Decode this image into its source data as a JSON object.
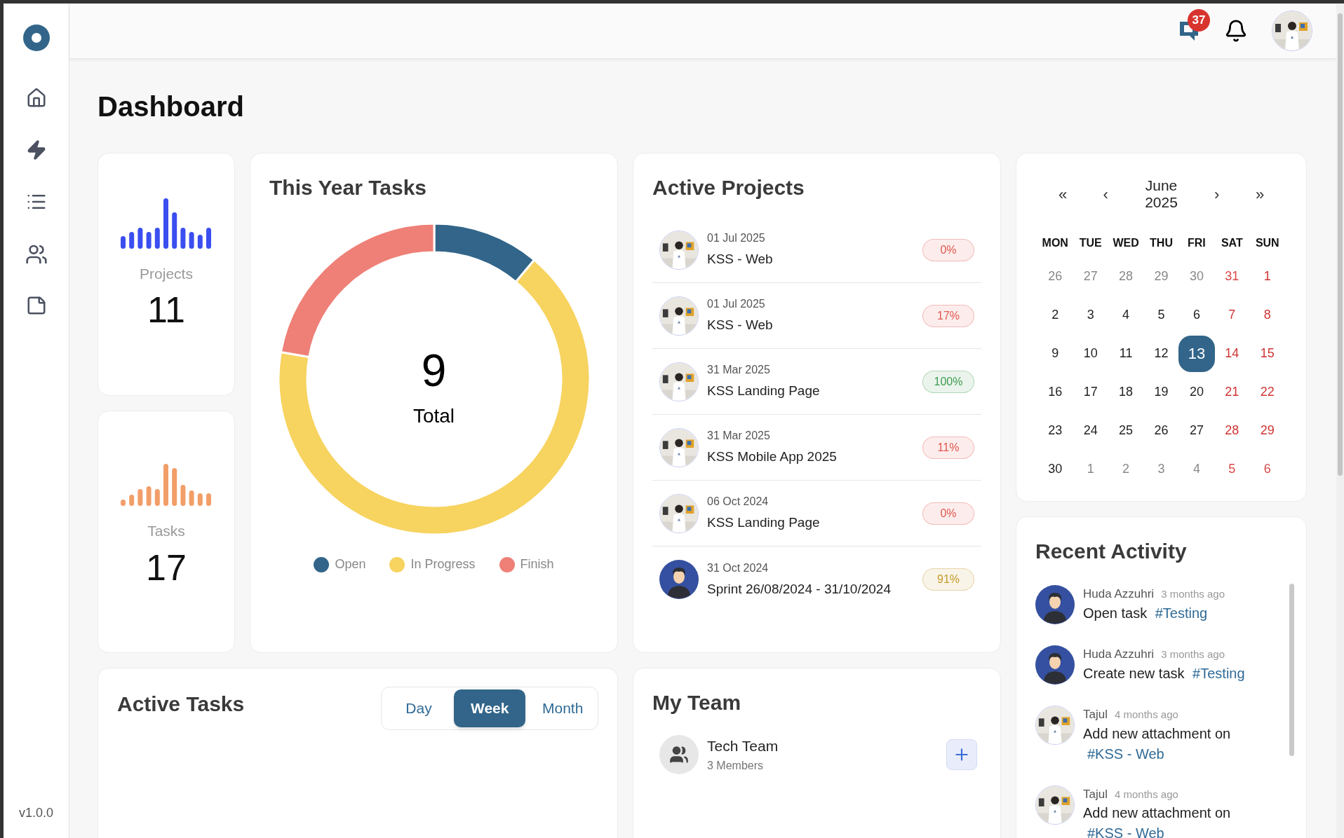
{
  "sidebar": {
    "version": "v1.0.0"
  },
  "header": {
    "message_count": "37"
  },
  "title": "Dashboard",
  "stats": [
    {
      "label": "Projects",
      "value": "11",
      "kind": "projects"
    },
    {
      "label": "Tasks",
      "value": "17",
      "kind": "tasks"
    }
  ],
  "year_tasks": {
    "title": "This Year Tasks",
    "total": "9",
    "total_label": "Total",
    "legend": [
      {
        "label": "Open",
        "color": "#326589"
      },
      {
        "label": "In Progress",
        "color": "#f7d35f"
      },
      {
        "label": "Finish",
        "color": "#ee8077"
      }
    ]
  },
  "active_projects": {
    "title": "Active Projects",
    "items": [
      {
        "date": "01 Jul 2025",
        "name": "KSS - Web",
        "progress": "0%",
        "color": "#e0574f"
      },
      {
        "date": "01 Jul 2025",
        "name": "KSS - Web",
        "progress": "17%",
        "color": "#e0574f"
      },
      {
        "date": "31 Mar 2025",
        "name": "KSS Landing Page",
        "progress": "100%",
        "color": "#3e9b4f"
      },
      {
        "date": "31 Mar 2025",
        "name": "KSS Mobile App 2025",
        "progress": "11%",
        "color": "#e0574f"
      },
      {
        "date": "06 Oct 2024",
        "name": "KSS Landing Page",
        "progress": "0%",
        "color": "#e0574f"
      },
      {
        "date": "31 Oct 2024",
        "name": "Sprint 26/08/2024 - 31/10/2024",
        "progress": "91%",
        "color": "#c49a2a",
        "kind": "icon"
      }
    ]
  },
  "calendar": {
    "nav": [
      "«",
      "‹",
      "›",
      "»"
    ],
    "month": "June",
    "year": "2025",
    "weekdays": [
      "MON",
      "TUE",
      "WED",
      "THU",
      "FRI",
      "SAT",
      "SUN"
    ],
    "days": [
      {
        "label": "26",
        "muted": true,
        "selected": false
      },
      {
        "label": "27",
        "muted": true,
        "selected": false
      },
      {
        "label": "28",
        "muted": true,
        "selected": false
      },
      {
        "label": "29",
        "muted": true,
        "selected": false
      },
      {
        "label": "30",
        "muted": true,
        "selected": false
      },
      {
        "label": "31",
        "muted": true,
        "selected": false
      },
      {
        "label": "1",
        "muted": false,
        "selected": false
      },
      {
        "label": "2",
        "muted": false,
        "selected": false
      },
      {
        "label": "3",
        "muted": false,
        "selected": false
      },
      {
        "label": "4",
        "muted": false,
        "selected": false
      },
      {
        "label": "5",
        "muted": false,
        "selected": false
      },
      {
        "label": "6",
        "muted": false,
        "selected": false
      },
      {
        "label": "7",
        "muted": false,
        "selected": false
      },
      {
        "label": "8",
        "muted": false,
        "selected": false
      },
      {
        "label": "9",
        "muted": false,
        "selected": false
      },
      {
        "label": "10",
        "muted": false,
        "selected": false
      },
      {
        "label": "11",
        "muted": false,
        "selected": false
      },
      {
        "label": "12",
        "muted": false,
        "selected": false
      },
      {
        "label": "13",
        "muted": false,
        "selected": true
      },
      {
        "label": "14",
        "muted": false,
        "selected": false
      },
      {
        "label": "15",
        "muted": false,
        "selected": false
      },
      {
        "label": "16",
        "muted": false,
        "selected": false
      },
      {
        "label": "17",
        "muted": false,
        "selected": false
      },
      {
        "label": "18",
        "muted": false,
        "selected": false
      },
      {
        "label": "19",
        "muted": false,
        "selected": false
      },
      {
        "label": "20",
        "muted": false,
        "selected": false
      },
      {
        "label": "21",
        "muted": false,
        "selected": false
      },
      {
        "label": "22",
        "muted": false,
        "selected": false
      },
      {
        "label": "23",
        "muted": false,
        "selected": false
      },
      {
        "label": "24",
        "muted": false,
        "selected": false
      },
      {
        "label": "25",
        "muted": false,
        "selected": false
      },
      {
        "label": "26",
        "muted": false,
        "selected": false
      },
      {
        "label": "27",
        "muted": false,
        "selected": false
      },
      {
        "label": "28",
        "muted": false,
        "selected": false
      },
      {
        "label": "29",
        "muted": false,
        "selected": false
      },
      {
        "label": "30",
        "muted": false,
        "selected": false
      },
      {
        "label": "1",
        "muted": true,
        "selected": false
      },
      {
        "label": "2",
        "muted": true,
        "selected": false
      },
      {
        "label": "3",
        "muted": true,
        "selected": false
      },
      {
        "label": "4",
        "muted": true,
        "selected": false
      },
      {
        "label": "5",
        "muted": true,
        "selected": false
      },
      {
        "label": "6",
        "muted": true,
        "selected": false
      }
    ]
  },
  "recent_activity": {
    "title": "Recent Activity",
    "items": [
      {
        "user": "Huda Azzuhri",
        "time": "3 months ago",
        "text": "Open task",
        "tag": "#Testing",
        "kind": "icon"
      },
      {
        "user": "Huda Azzuhri",
        "time": "3 months ago",
        "text": "Create new task",
        "tag": "#Testing",
        "kind": "icon"
      },
      {
        "user": "Tajul",
        "time": "4 months ago",
        "text": "Add new attachment on",
        "tag": "#KSS - Web"
      },
      {
        "user": "Tajul",
        "time": "4 months ago",
        "text": "Add new attachment on",
        "tag": "#KSS - Web"
      }
    ]
  },
  "active_tasks": {
    "title": "Active Tasks",
    "tabs": [
      {
        "label": "Day",
        "selected": false
      },
      {
        "label": "Week",
        "selected": true
      },
      {
        "label": "Month",
        "selected": false
      }
    ]
  },
  "my_team": {
    "title": "My Team",
    "teams": [
      {
        "name": "Tech Team",
        "members": "3 Members"
      }
    ]
  }
}
